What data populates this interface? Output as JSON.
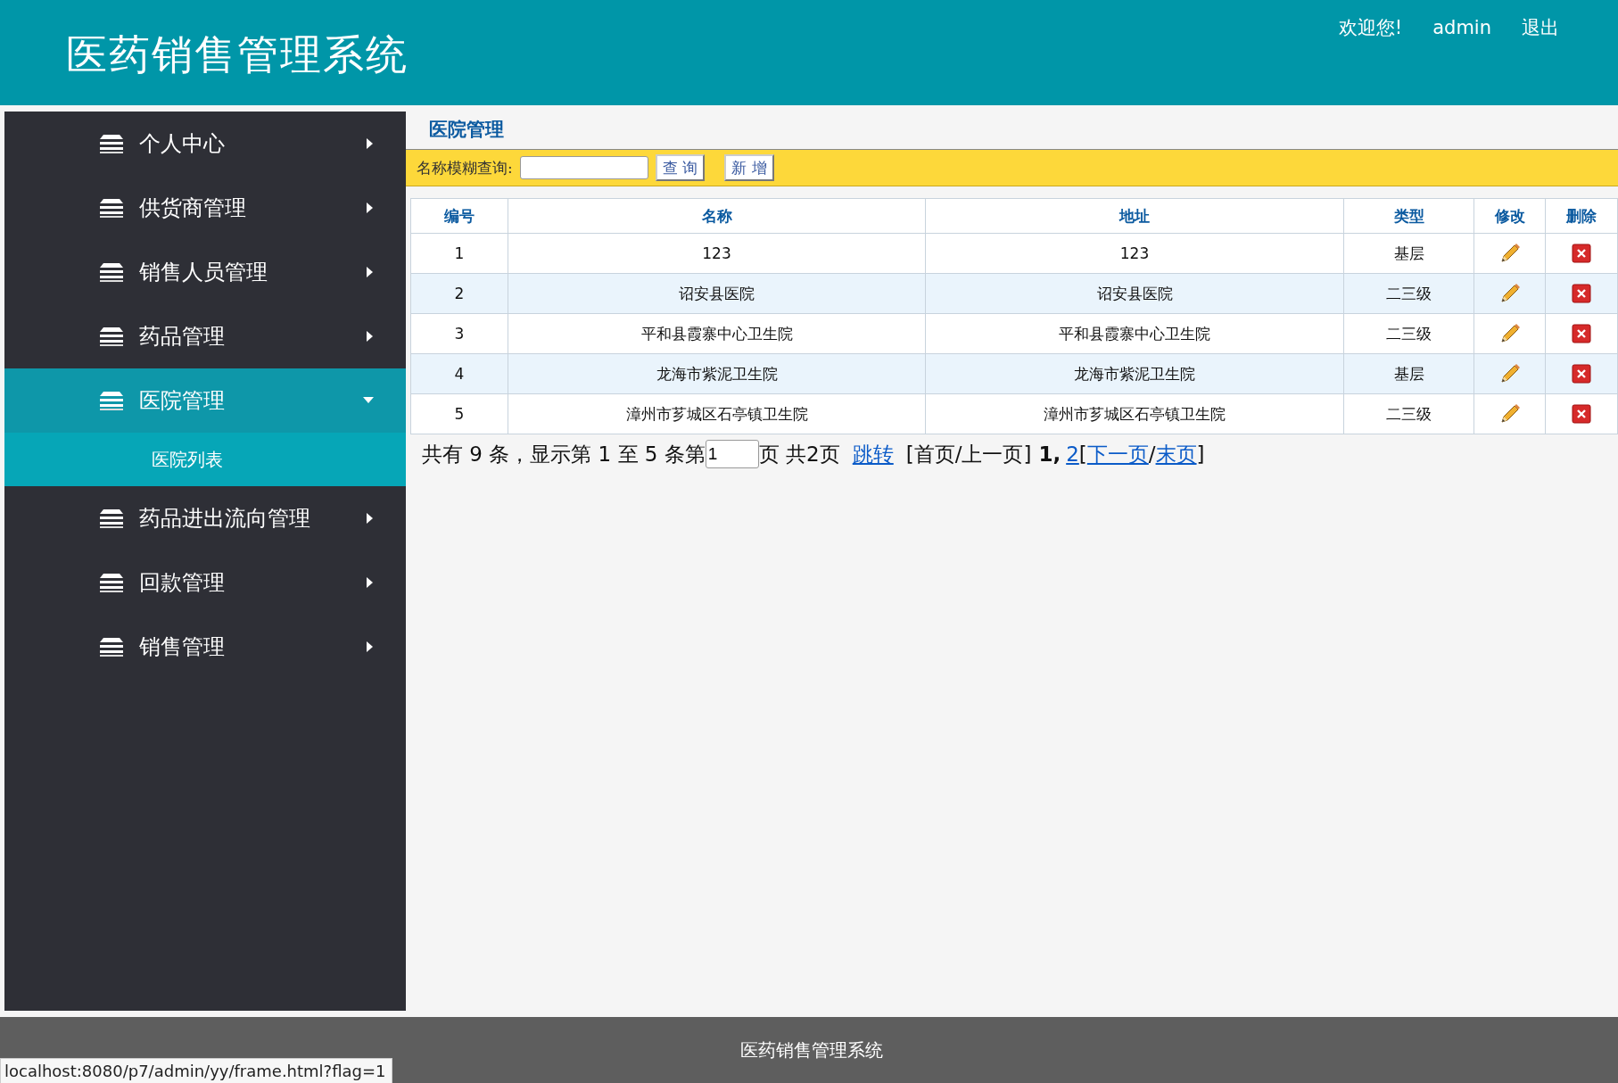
{
  "header": {
    "title": "医药销售管理系统",
    "welcome": "欢迎您!",
    "user": "admin",
    "logout": "退出"
  },
  "sidebar": {
    "items": [
      {
        "label": "个人中心",
        "expanded": false,
        "selected": false
      },
      {
        "label": "供货商管理",
        "expanded": false,
        "selected": false
      },
      {
        "label": "销售人员管理",
        "expanded": false,
        "selected": false
      },
      {
        "label": "药品管理",
        "expanded": false,
        "selected": false
      },
      {
        "label": "医院管理",
        "expanded": true,
        "selected": true,
        "children": [
          {
            "label": "医院列表",
            "selected": true
          }
        ]
      },
      {
        "label": "药品进出流向管理",
        "expanded": false,
        "selected": false
      },
      {
        "label": "回款管理",
        "expanded": false,
        "selected": false
      },
      {
        "label": "销售管理",
        "expanded": false,
        "selected": false
      }
    ]
  },
  "panel": {
    "title": "医院管理",
    "search_label": "名称模糊查询:",
    "buttons": [
      "查 询",
      "新 增"
    ]
  },
  "table": {
    "columns": [
      "编号",
      "名称",
      "地址",
      "类型",
      "修改",
      "删除"
    ],
    "rows": [
      {
        "id": "1",
        "name": "123",
        "address": "123",
        "type": "基层"
      },
      {
        "id": "2",
        "name": "诏安县医院",
        "address": "诏安县医院",
        "type": "二三级"
      },
      {
        "id": "3",
        "name": "平和县霞寨中心卫生院",
        "address": "平和县霞寨中心卫生院",
        "type": "二三级"
      },
      {
        "id": "4",
        "name": "龙海市紫泥卫生院",
        "address": "龙海市紫泥卫生院",
        "type": "基层"
      },
      {
        "id": "5",
        "name": "漳州市芗城区石亭镇卫生院",
        "address": "漳州市芗城区石亭镇卫生院",
        "type": "二三级"
      }
    ]
  },
  "pagination": [
    {
      "kind": "text",
      "text": "共有 9 条，显示第 1 至 5 条第"
    },
    {
      "kind": "input",
      "text": "1"
    },
    {
      "kind": "text",
      "text": "页 共2页"
    },
    {
      "kind": "link",
      "text": "跳转"
    },
    {
      "kind": "text",
      "text": "[首页/上一页]"
    },
    {
      "kind": "bold",
      "text": "1,"
    },
    {
      "kind": "link",
      "text": "2"
    },
    {
      "kind": "text",
      "text": "["
    },
    {
      "kind": "link",
      "text": "下一页"
    },
    {
      "kind": "text",
      "text": "/"
    },
    {
      "kind": "link",
      "text": "末页"
    },
    {
      "kind": "text",
      "text": "]"
    }
  ],
  "footer": {
    "text": "医药销售管理系统"
  },
  "status_bar": {
    "url": "localhost:8080/p7/admin/yy/frame.html?flag=1"
  }
}
